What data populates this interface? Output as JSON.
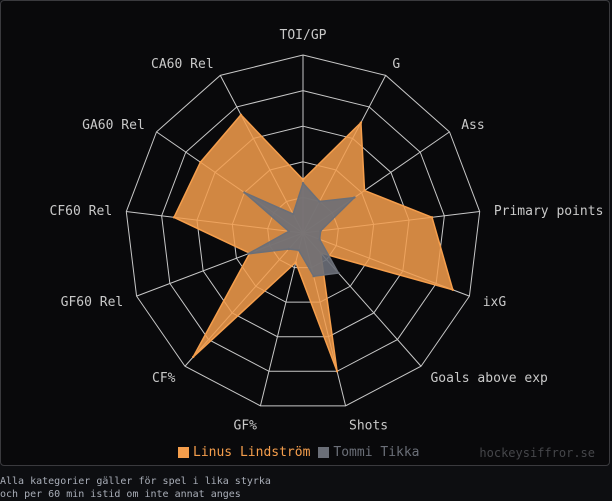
{
  "chart_data": {
    "type": "radar",
    "axes": [
      "TOI/GP",
      "G",
      "Ass",
      "Primary points",
      "ixG",
      "Goals above exp",
      "Shots",
      "GF%",
      "CF%",
      "GF60 Rel",
      "CF60 Rel",
      "GA60 Rel",
      "CA60 Rel"
    ],
    "range": [
      0,
      100
    ],
    "grid_levels": [
      20,
      40,
      60,
      80,
      100
    ],
    "series": [
      {
        "name": "Linus Lindström",
        "color": "#f59e4c",
        "values": [
          30,
          70,
          42,
          73,
          90,
          15,
          80,
          17,
          93,
          32,
          73,
          70,
          75
        ]
      },
      {
        "name": "Tommi Tikka",
        "color": "#6b6f78",
        "values": [
          28,
          20,
          35,
          10,
          10,
          30,
          25,
          10,
          12,
          33,
          8,
          40,
          12
        ]
      }
    ]
  },
  "legend": {
    "series_1": "Linus Lindström",
    "series_2": "Tommi Tikka"
  },
  "credit": "hockeysiffror.se",
  "footnote": {
    "line1": "Alla kategorier gäller för spel i lika styrka",
    "line2": "och per 60 min istid om inte annat anges"
  },
  "colors": {
    "background": "#09090b",
    "grid": "#c8c8c8",
    "label": "#c9c9c9",
    "series_1": "#f59e4c",
    "series_2": "#6b6f78"
  }
}
